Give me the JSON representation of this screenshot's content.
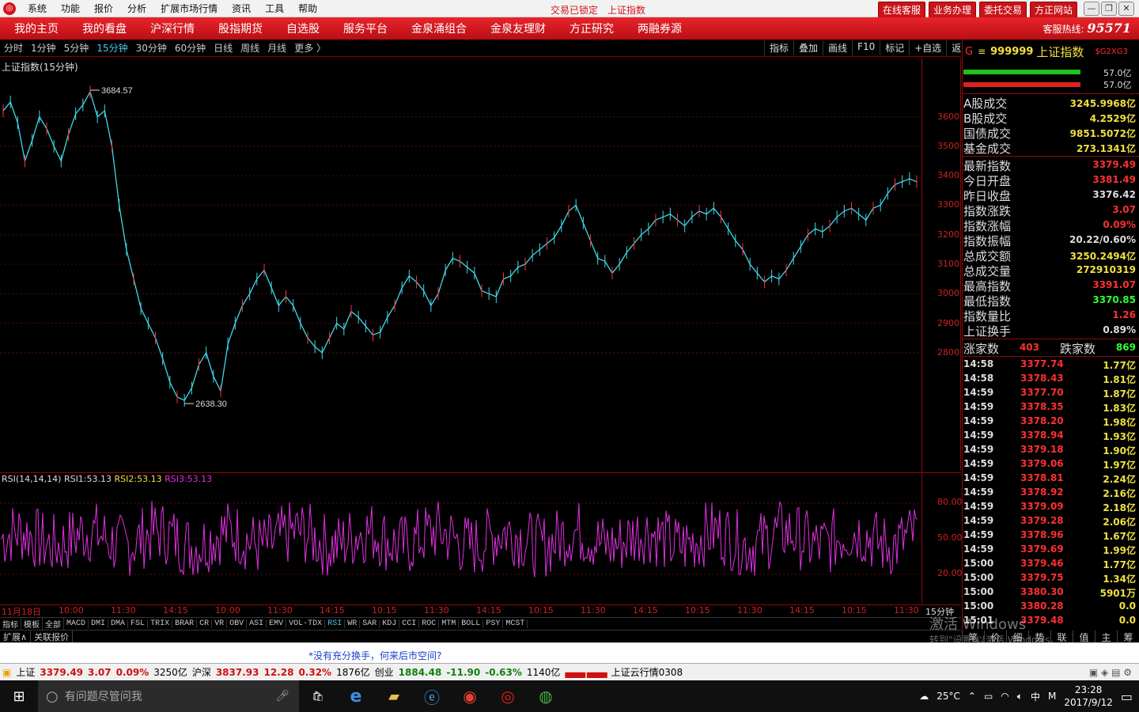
{
  "app": {
    "menu": [
      "系统",
      "功能",
      "报价",
      "分析",
      "扩展市场行情",
      "资讯",
      "工具",
      "帮助"
    ],
    "status_locked": "交易已锁定",
    "title": "上证指数",
    "buttons": [
      "在线客服",
      "业务办理",
      "委托交易",
      "方正网站"
    ]
  },
  "nav": {
    "tabs": [
      "我的主页",
      "我的看盘",
      "沪深行情",
      "股指期货",
      "自选股",
      "服务平台",
      "金泉涌组合",
      "金泉友理财",
      "方正研究",
      "两融券源"
    ],
    "hotline_label": "客服热线:",
    "hotline_number": "95571"
  },
  "toolbar": {
    "periods": [
      "分时",
      "1分钟",
      "5分钟",
      "15分钟",
      "30分钟",
      "60分钟",
      "日线",
      "周线",
      "月线",
      "更多 〉"
    ],
    "active": "15分钟",
    "right": [
      "指标",
      "叠加",
      "画线",
      "F10",
      "标记",
      "+自选",
      "返回"
    ]
  },
  "chart_data": {
    "type": "line",
    "title": "上证指数(15分钟)",
    "y_ticks": [
      "3600",
      "3500",
      "3400",
      "3300",
      "3200",
      "3100",
      "3000",
      "2900",
      "2800"
    ],
    "ylim": [
      2638.3,
      3684.57
    ],
    "high_label": "3684.57",
    "low_label": "2638.30",
    "last_value": 3379.49,
    "values": [
      3620,
      3650,
      3580,
      3450,
      3520,
      3600,
      3560,
      3500,
      3450,
      3540,
      3610,
      3640,
      3684.57,
      3600,
      3620,
      3500,
      3300,
      3150,
      3050,
      2950,
      2900,
      2850,
      2780,
      2700,
      2650,
      2638.3,
      2680,
      2760,
      2800,
      2720,
      2670,
      2830,
      2900,
      2960,
      3000,
      3050,
      3080,
      3020,
      2960,
      2990,
      2960,
      2900,
      2850,
      2820,
      2800,
      2850,
      2900,
      2880,
      2940,
      2920,
      2890,
      2860,
      2870,
      2920,
      2960,
      3020,
      3060,
      3040,
      3010,
      2960,
      3000,
      3080,
      3120,
      3110,
      3090,
      3070,
      3010,
      3000,
      2990,
      3050,
      3060,
      3090,
      3100,
      3130,
      3150,
      3170,
      3190,
      3230,
      3280,
      3300,
      3240,
      3180,
      3120,
      3110,
      3070,
      3100,
      3140,
      3170,
      3200,
      3220,
      3250,
      3260,
      3270,
      3250,
      3230,
      3260,
      3280,
      3270,
      3290,
      3260,
      3220,
      3180,
      3150,
      3100,
      3070,
      3040,
      3060,
      3050,
      3080,
      3120,
      3160,
      3200,
      3220,
      3210,
      3230,
      3260,
      3280,
      3290,
      3270,
      3250,
      3290,
      3300,
      3340,
      3370,
      3380,
      3390,
      3379.49
    ]
  },
  "rsi": {
    "label": "RSI(14,14,14)",
    "rsi1_label": "RSI1:",
    "rsi1": "53.13",
    "rsi2_label": "RSI2:",
    "rsi2": "53.13",
    "rsi3_label": "RSI3:",
    "rsi3": "53.13",
    "ticks": [
      "80.00",
      "50.00",
      "20.00"
    ]
  },
  "time_axis": {
    "labels": [
      "11月18日",
      "10:00",
      "11:30",
      "14:15",
      "10:00",
      "11:30",
      "14:15",
      "10:15",
      "11:30",
      "14:15",
      "10:15",
      "11:30",
      "14:15",
      "10:15",
      "11:30",
      "14:15",
      "10:15",
      "11:30"
    ],
    "period": "15分钟"
  },
  "indicators": {
    "items": [
      "指标",
      "模板",
      "全部",
      "MACD",
      "DMI",
      "DMA",
      "FSL",
      "TRIX",
      "BRAR",
      "CR",
      "VR",
      "OBV",
      "ASI",
      "EMV",
      "VOL-TDX",
      "RSI",
      "WR",
      "SAR",
      "KDJ",
      "CCI",
      "ROC",
      "MTM",
      "BOLL",
      "PSY",
      "MCST"
    ],
    "active": "RSI",
    "ext": [
      "扩展∧",
      "关联报价"
    ]
  },
  "stock": {
    "code": "999999",
    "name": "上证指数",
    "tag": "$G2XG3",
    "bar_pct1": "57.0亿",
    "bar_pct2": "57.0亿",
    "turnover": [
      [
        "A股成交",
        "3245.9968亿"
      ],
      [
        "B股成交",
        "4.2529亿"
      ],
      [
        "国债成交",
        "9851.5072亿"
      ],
      [
        "基金成交",
        "273.1341亿"
      ]
    ],
    "quote": [
      [
        "最新指数",
        "3379.49",
        "#ff3030"
      ],
      [
        "今日开盘",
        "3381.49",
        "#ff3030"
      ],
      [
        "昨日收盘",
        "3376.42",
        "#dddddd"
      ],
      [
        "指数涨跌",
        "3.07",
        "#ff3030"
      ],
      [
        "指数涨幅",
        "0.09%",
        "#ff3030"
      ],
      [
        "指数振幅",
        "20.22/0.60%",
        "#dddddd"
      ],
      [
        "总成交额",
        "3250.2494亿",
        "#f0e040"
      ],
      [
        "总成交量",
        "272910319",
        "#f0e040"
      ],
      [
        "最高指数",
        "3391.07",
        "#ff3030"
      ],
      [
        "最低指数",
        "3370.85",
        "#30ff30"
      ],
      [
        "指数量比",
        "1.26",
        "#ff3030"
      ],
      [
        "上证换手",
        "0.89%",
        "#dddddd"
      ]
    ],
    "up_label": "涨家数",
    "up": "403",
    "down_label": "跌家数",
    "down": "869"
  },
  "ticks": [
    [
      "14:58",
      "3377.74",
      "1.77亿"
    ],
    [
      "14:58",
      "3378.43",
      "1.81亿"
    ],
    [
      "14:59",
      "3377.70",
      "1.87亿"
    ],
    [
      "14:59",
      "3378.35",
      "1.83亿"
    ],
    [
      "14:59",
      "3378.20",
      "1.98亿"
    ],
    [
      "14:59",
      "3378.94",
      "1.93亿"
    ],
    [
      "14:59",
      "3379.18",
      "1.90亿"
    ],
    [
      "14:59",
      "3379.06",
      "1.97亿"
    ],
    [
      "14:59",
      "3378.81",
      "2.24亿"
    ],
    [
      "14:59",
      "3378.92",
      "2.16亿"
    ],
    [
      "14:59",
      "3379.09",
      "2.18亿"
    ],
    [
      "14:59",
      "3379.28",
      "2.06亿"
    ],
    [
      "14:59",
      "3378.96",
      "1.67亿"
    ],
    [
      "14:59",
      "3379.69",
      "1.99亿"
    ],
    [
      "15:00",
      "3379.46",
      "1.77亿"
    ],
    [
      "15:00",
      "3379.75",
      "1.34亿"
    ],
    [
      "15:00",
      "3380.30",
      "5901万"
    ],
    [
      "15:00",
      "3380.28",
      "0.0"
    ],
    [
      "15:01",
      "3379.48",
      "0.0"
    ]
  ],
  "right_tabs": [
    "笔",
    "价",
    "细",
    "势",
    "联",
    "值",
    "主",
    "筹"
  ],
  "status_msg": "*没有充分换手，何来后市空间?",
  "bottom": {
    "sh_label": "上证",
    "sh": "3379.49",
    "sh_chg": "3.07",
    "sh_pct": "0.09%",
    "sh_vol": "3250亿",
    "hs_label": "沪深",
    "hs": "3837.93",
    "hs_chg": "12.28",
    "hs_pct": "0.32%",
    "hs_vol": "1876亿",
    "cy_label": "创业",
    "cy": "1884.48",
    "cy_chg": "-11.90",
    "cy_pct": "-0.63%",
    "cy_vol": "1140亿",
    "cloud": "上证云行情0308"
  },
  "taskbar": {
    "search": "有问题尽管问我",
    "temp": "25°C",
    "ime": "中",
    "time": "23:28",
    "date": "2017/9/12"
  },
  "watermark": {
    "line1": "激活 Windows",
    "line2": "转到\"设置\"以激活 Windows。"
  }
}
